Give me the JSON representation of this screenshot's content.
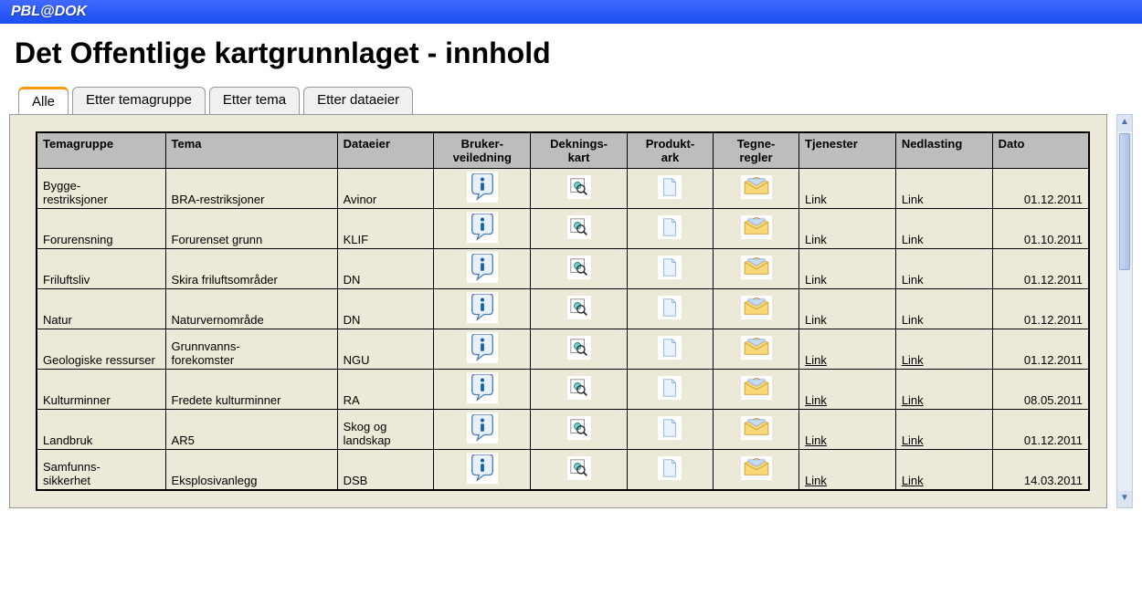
{
  "app": {
    "title": "PBL@DOK"
  },
  "page": {
    "heading": "Det Offentlige kartgrunnlaget - innhold"
  },
  "tabs": [
    {
      "label": "Alle",
      "active": true
    },
    {
      "label": "Etter temagruppe",
      "active": false
    },
    {
      "label": "Etter tema",
      "active": false
    },
    {
      "label": "Etter dataeier",
      "active": false
    }
  ],
  "columns": {
    "temagruppe": "Temagruppe",
    "tema": "Tema",
    "dataeier": "Dataeier",
    "brukerveiledning": "Bruker-veiledning",
    "dekningskart": "Deknings-kart",
    "produktark": "Produkt-ark",
    "tegneregler": "Tegne-regler",
    "tjenester": "Tjenester",
    "nedlasting": "Nedlasting",
    "dato": "Dato"
  },
  "rows": [
    {
      "temagruppe": "Bygge-restriksjoner",
      "tema": "BRA-restriksjoner",
      "dataeier": "Avinor",
      "tjenester": "Link",
      "nedlasting": "Link",
      "dato": "01.12.2011",
      "link_underline": false
    },
    {
      "temagruppe": "Forurensning",
      "tema": "Forurenset grunn",
      "dataeier": "KLIF",
      "tjenester": "Link",
      "nedlasting": "Link",
      "dato": "01.10.2011",
      "link_underline": false
    },
    {
      "temagruppe": "Friluftsliv",
      "tema": "Skira friluftsområder",
      "dataeier": "DN",
      "tjenester": "Link",
      "nedlasting": "Link",
      "dato": "01.12.2011",
      "link_underline": false
    },
    {
      "temagruppe": "Natur",
      "tema": "Naturvernområde",
      "dataeier": "DN",
      "tjenester": "Link",
      "nedlasting": "Link",
      "dato": "01.12.2011",
      "link_underline": false
    },
    {
      "temagruppe": "Geologiske ressurser",
      "tema": "Grunnvanns-forekomster",
      "dataeier": "NGU",
      "tjenester": "Link",
      "nedlasting": "Link",
      "dato": "01.12.2011",
      "link_underline": true
    },
    {
      "temagruppe": "Kulturminner",
      "tema": "Fredete kulturminner",
      "dataeier": "RA",
      "tjenester": "Link",
      "nedlasting": "Link",
      "dato": "08.05.2011",
      "link_underline": true
    },
    {
      "temagruppe": "Landbruk",
      "tema": "AR5",
      "dataeier": "Skog og landskap",
      "tjenester": "Link",
      "nedlasting": "Link",
      "dato": "01.12.2011",
      "link_underline": true
    },
    {
      "temagruppe": "Samfunns-sikkerhet",
      "tema": "Eksplosivanlegg",
      "dataeier": "DSB",
      "tjenester": "Link",
      "nedlasting": "Link",
      "dato": "14.03.2011",
      "link_underline": true
    }
  ],
  "icons": {
    "info": "info-icon",
    "map": "map-search-icon",
    "doc": "document-icon",
    "rules": "envelope-icon"
  }
}
